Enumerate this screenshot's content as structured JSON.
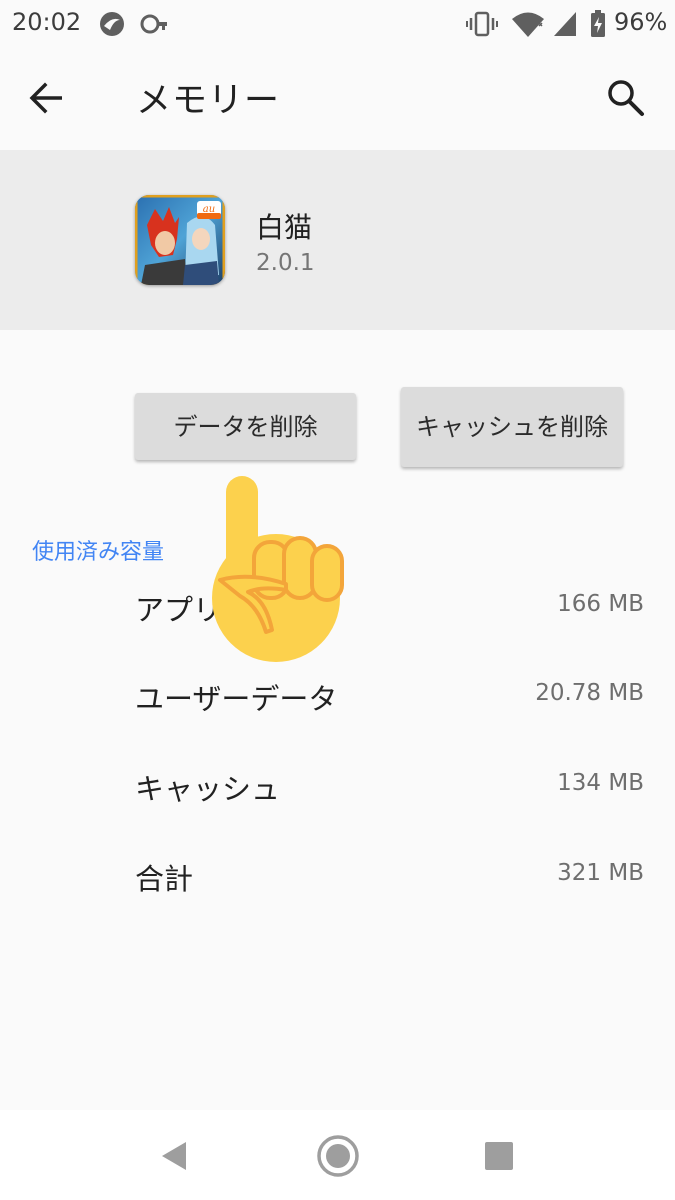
{
  "status_bar": {
    "time": "20:02",
    "battery": "96%",
    "icons": [
      "notification-app-icon",
      "key-icon",
      "vibrate-icon",
      "wifi-icon",
      "signal-icon",
      "battery-icon"
    ]
  },
  "app_bar": {
    "back_icon": "arrow-left-icon",
    "title": "メモリー",
    "search_icon": "search-icon"
  },
  "app_info": {
    "name": "白猫",
    "version": "2.0.1",
    "icon_badge": "au"
  },
  "actions": {
    "clear_data": "データを削除",
    "clear_cache": "キャッシュを削除"
  },
  "storage": {
    "header": "使用済み容量",
    "rows": [
      {
        "label": "アプリ",
        "value": "166 MB"
      },
      {
        "label": "ユーザーデータ",
        "value": "20.78 MB"
      },
      {
        "label": "キャッシュ",
        "value": "134 MB"
      },
      {
        "label": "合計",
        "value": "321 MB"
      }
    ]
  },
  "nav_bar": {
    "icons": [
      "back-triangle-icon",
      "home-circle-icon",
      "recents-square-icon"
    ]
  },
  "colors": {
    "accent": "#4285f4",
    "background": "#fafafa",
    "header_background": "#ececec",
    "button": "#dcdcdc",
    "hand": "#fcd14d",
    "hand_outline": "#f3a53a"
  }
}
